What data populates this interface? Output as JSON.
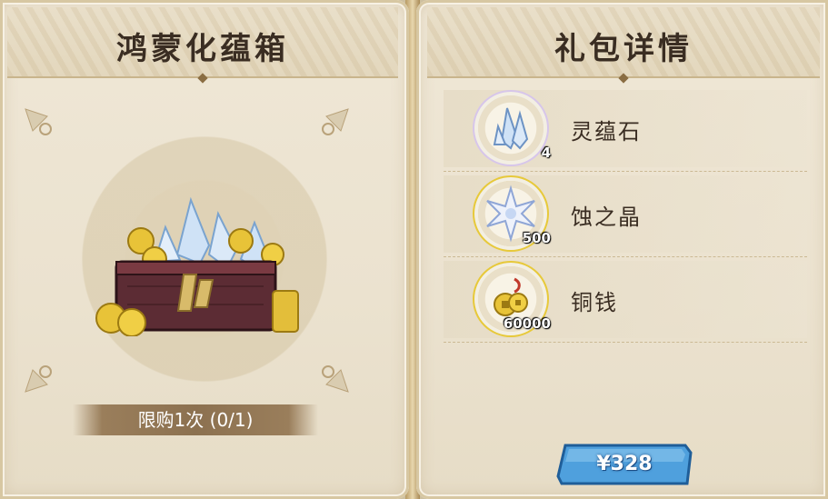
{
  "left_panel": {
    "title": "鸿蒙化蕴箱",
    "limit_text": "限购1次 (0/1)"
  },
  "right_panel": {
    "title": "礼包详情",
    "items": [
      {
        "name": "灵蕴石",
        "quantity": "4",
        "icon": "crystal-icon"
      },
      {
        "name": "蚀之晶",
        "quantity": "500",
        "icon": "star-crystal-icon"
      },
      {
        "name": "铜钱",
        "quantity": "60000",
        "icon": "copper-coin-icon"
      }
    ]
  },
  "purchase": {
    "price": "¥328"
  },
  "colors": {
    "panel_bg": "#ebe2cf",
    "title_text": "#3a2d22",
    "price_button": "#4fa0dd"
  }
}
